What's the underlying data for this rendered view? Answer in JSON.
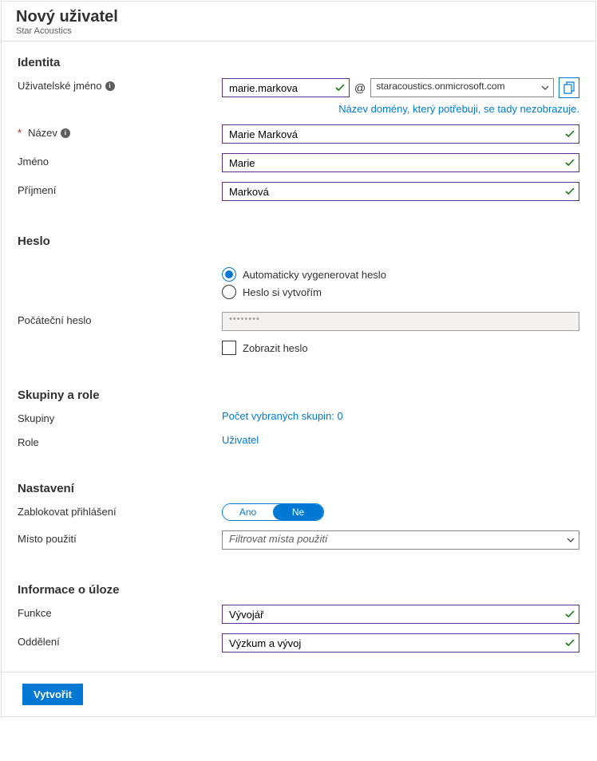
{
  "header": {
    "title": "Nový uživatel",
    "subtitle": "Star Acoustics"
  },
  "identity": {
    "section": "Identita",
    "username_label": "Uživatelské jméno",
    "username_value": "marie.markova",
    "at": "@",
    "domain_value": "staracoustics.onmicrosoft.com",
    "domain_hint": "Název domény, který potřebuji, se tady nezobrazuje.",
    "name_label": "Název",
    "name_value": "Marie Marková",
    "first_label": "Jméno",
    "first_value": "Marie",
    "last_label": "Příjmení",
    "last_value": "Marková"
  },
  "password": {
    "section": "Heslo",
    "option_auto": "Automaticky vygenerovat heslo",
    "option_manual": "Heslo si vytvořím",
    "initial_label": "Počáteční heslo",
    "masked": "••••••••",
    "show_label": "Zobrazit heslo"
  },
  "groups": {
    "section": "Skupiny a role",
    "groups_label": "Skupiny",
    "groups_value": "Počet vybraných skupin: 0",
    "roles_label": "Role",
    "roles_value": "Uživatel"
  },
  "settings": {
    "section": "Nastavení",
    "block_label": "Zablokovat přihlášení",
    "toggle_yes": "Ano",
    "toggle_no": "Ne",
    "location_label": "Místo použití",
    "location_placeholder": "Filtrovat místa použití"
  },
  "job": {
    "section": "Informace o úloze",
    "function_label": "Funkce",
    "function_value": "Vývojář",
    "dept_label": "Oddělení",
    "dept_value": "Výzkum a vývoj"
  },
  "footer": {
    "create": "Vytvořit"
  }
}
